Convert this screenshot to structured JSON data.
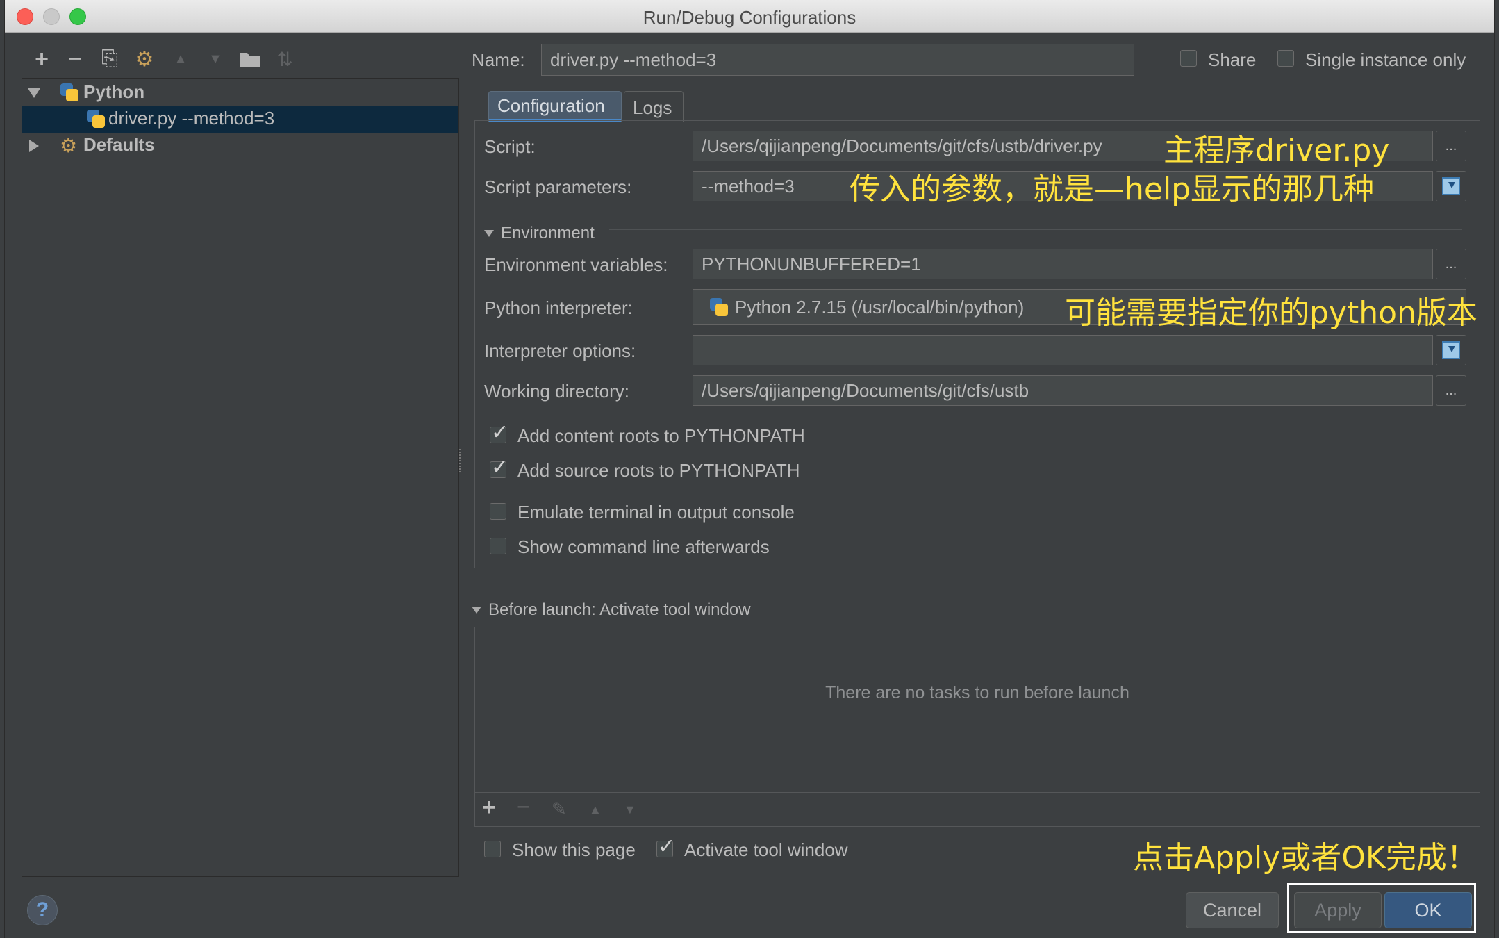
{
  "window": {
    "title": "Run/Debug Configurations"
  },
  "toolbar": {
    "add": "+",
    "remove": "−",
    "copy": "⎘",
    "edit_defaults": "⚙",
    "move_up": "▲",
    "move_down": "▼",
    "folder": "▬",
    "sort": "⇅"
  },
  "tree": {
    "python_group": "Python",
    "python_item": "driver.py --method=3",
    "defaults": "Defaults"
  },
  "header": {
    "name_label": "Name:",
    "name_value": "driver.py --method=3",
    "share_label": "Share",
    "single_instance_label": "Single instance only"
  },
  "tabs": [
    "Configuration",
    "Logs"
  ],
  "config": {
    "script_label": "Script:",
    "script_value": "/Users/qijianpeng/Documents/git/cfs/ustb/driver.py",
    "params_label": "Script parameters:",
    "params_value": "--method=3",
    "environment_label": "Environment",
    "env_vars_label": "Environment variables:",
    "env_vars_value": "PYTHONUNBUFFERED=1",
    "interpreter_label": "Python interpreter:",
    "interpreter_value": "Python 2.7.15 (/usr/local/bin/python)",
    "interp_options_label": "Interpreter options:",
    "interp_options_value": "",
    "workdir_label": "Working directory:",
    "workdir_value": "/Users/qijianpeng/Documents/git/cfs/ustb",
    "browse": "...",
    "checkboxes": [
      {
        "label": "Add content roots to PYTHONPATH",
        "checked": true
      },
      {
        "label": "Add source roots to PYTHONPATH",
        "checked": true
      },
      {
        "label": "Emulate terminal in output console",
        "checked": false
      },
      {
        "label": "Show command line afterwards",
        "checked": false
      }
    ]
  },
  "before_launch": {
    "title": "Before launch: Activate tool window",
    "empty_text": "There are no tasks to run before launch",
    "add": "+",
    "remove": "−",
    "edit": "✎",
    "up": "▲",
    "down": "▼"
  },
  "bottom": {
    "show_page_label": "Show this page",
    "show_page_checked": false,
    "activate_label": "Activate tool window",
    "activate_checked": true,
    "help": "?",
    "cancel": "Cancel",
    "apply": "Apply",
    "ok": "OK"
  },
  "annotations": {
    "script": "主程序driver.py",
    "params": "传入的参数，就是—help显示的那几种",
    "interpreter": "可能需要指定你的python版本",
    "finish": "点击Apply或者OK完成！"
  },
  "colors": {
    "annotation": "#ffe23d",
    "selection": "#0d293e",
    "ok_button": "#365880",
    "tab_selected": "#4a5a6b"
  }
}
